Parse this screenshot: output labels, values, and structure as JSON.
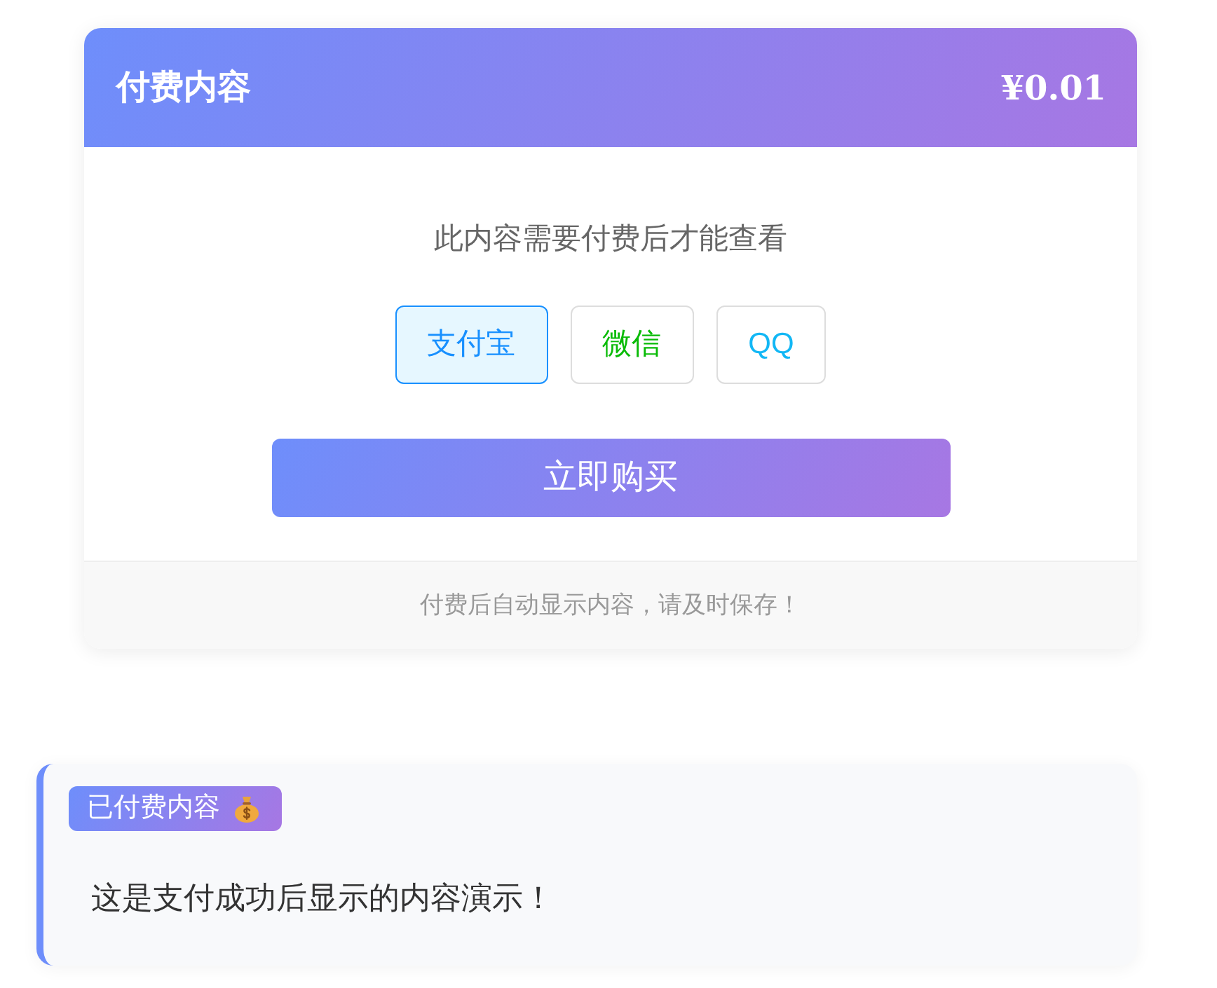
{
  "paywall": {
    "title": "付费内容",
    "price": "¥0.01",
    "notice": "此内容需要付费后才能查看",
    "payment_methods": [
      {
        "label": "支付宝",
        "selected": true,
        "color": "#1890ff"
      },
      {
        "label": "微信",
        "selected": false,
        "color": "#09bb07"
      },
      {
        "label": "QQ",
        "selected": false,
        "color": "#12b7f5"
      }
    ],
    "buy_button": "立即购买",
    "footer": "付费后自动显示内容，请及时保存！"
  },
  "paid_content": {
    "badge": "已付费内容",
    "text": "这是支付成功后显示的内容演示！"
  }
}
